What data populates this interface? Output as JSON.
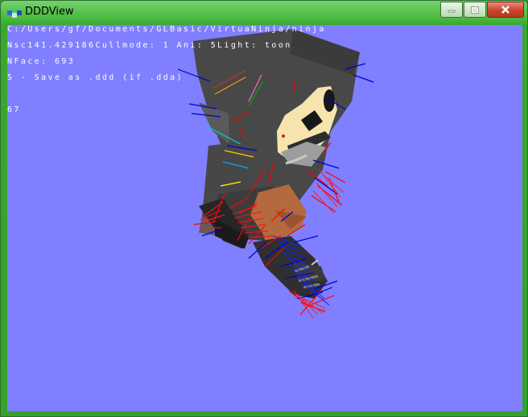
{
  "window": {
    "title": "DDDView",
    "icon": "ddd-app-icon",
    "controls": {
      "minimize": "minimize-icon",
      "maximize": "maximize-icon",
      "close": "close-icon"
    }
  },
  "viewport": {
    "background_color": "#7f7fff",
    "hud": {
      "line1": "C:/Users/gf/Documents/GLBasic/VirtuaNinja/ninja",
      "line2": "Nsc141.429186Cullmode: 1 Ani: 5Light: toon",
      "line3": "NFace: 693",
      "line4": "S - Save as .ddd (if .dda)",
      "line5": "67"
    }
  }
}
